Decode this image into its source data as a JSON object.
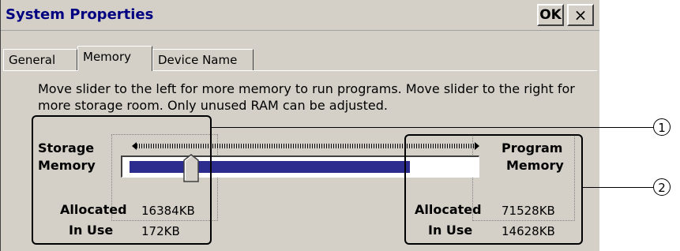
{
  "window": {
    "title": "System Properties",
    "ok_label": "OK",
    "close_label": "×"
  },
  "tabs": [
    {
      "label": "General",
      "active": false
    },
    {
      "label": "Memory",
      "active": true
    },
    {
      "label": "Device Name",
      "active": false
    }
  ],
  "memory": {
    "description": "Move slider to the left for more memory to run programs. Move slider to the right for more storage room. Only unused RAM can be adjusted.",
    "storage_label_line1": "Storage",
    "storage_label_line2": "Memory",
    "program_label_line1": "Program",
    "program_label_line2": "Memory",
    "storage": {
      "allocated_label": "Allocated",
      "allocated_value": "16384KB",
      "inuse_label": "In Use",
      "inuse_value": "172KB"
    },
    "program": {
      "allocated_label": "Allocated",
      "allocated_value": "71528KB",
      "inuse_label": "In Use",
      "inuse_value": "14628KB"
    },
    "slider_position": 0.19,
    "fill_fraction": 0.82
  },
  "callouts": [
    "1",
    "2"
  ],
  "colors": {
    "slider_fill": "#2c2c8e",
    "title_text": "#000080"
  }
}
